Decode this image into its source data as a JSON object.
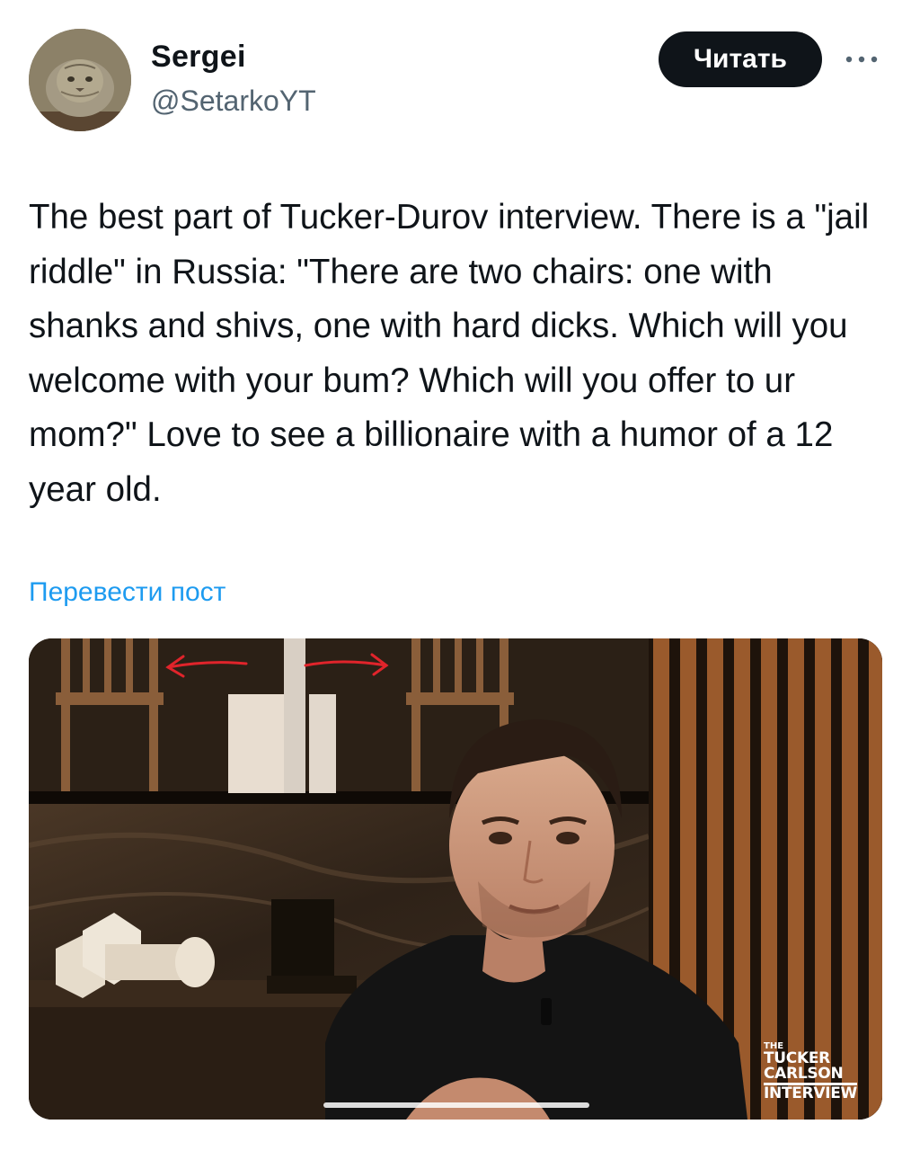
{
  "user": {
    "name": "Sergei",
    "handle": "@SetarkoYT",
    "avatar_icon": "manul-cat-avatar"
  },
  "follow_label": "Читать",
  "more_icon": "more-horizontal-icon",
  "tweet": {
    "text": "The best part of Tucker-Durov interview.  There is a \"jail riddle\" in Russia: \"There are two chairs: one with shanks and shivs, one with hard dicks. Which will you welcome with your bum? Which will you offer to ur mom?\" Love to see a billionaire with a humor of a 12 year old."
  },
  "translate_label": "Перевести пост",
  "media": {
    "watermark": {
      "line1": "THE",
      "line2": "TUCKER",
      "line3": "CARLSON",
      "line4": "INTERVIEW"
    },
    "annotation_color": "#e0242b"
  },
  "colors": {
    "link": "#1d9bf0",
    "text": "#0f1419",
    "secondary": "#536471",
    "button": "#0f1419"
  }
}
